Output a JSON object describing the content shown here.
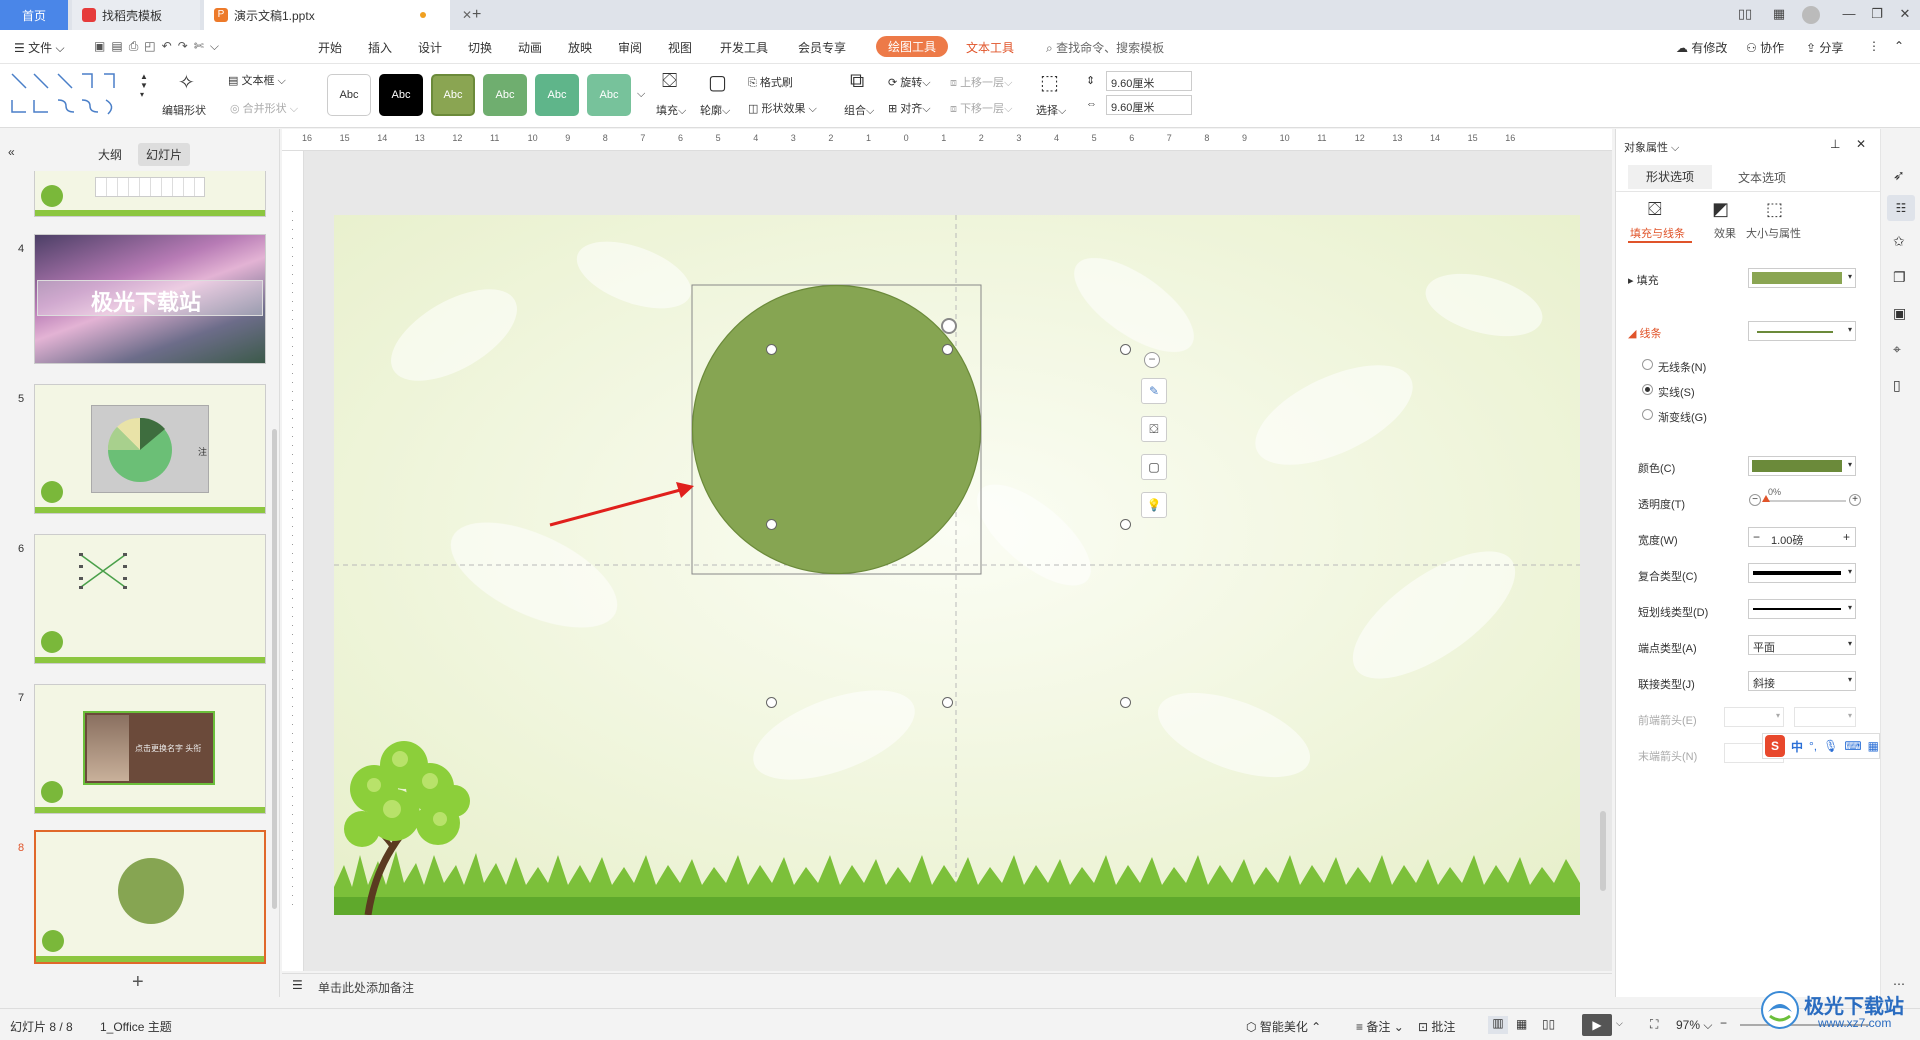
{
  "titlebar": {
    "tab_home": "首页",
    "tab_templates": "找稻壳模板",
    "tab_doc": "演示文稿1.pptx",
    "new_tab": "+"
  },
  "menubar": {
    "file": "文件",
    "items": [
      "开始",
      "插入",
      "设计",
      "切换",
      "动画",
      "放映",
      "审阅",
      "视图",
      "开发工具",
      "会员专享"
    ],
    "draw_tools": "绘图工具",
    "text_tools": "文本工具",
    "search": "查找命令、搜索模板",
    "modified": "有修改",
    "collab": "协作",
    "share": "分享"
  },
  "ribbon": {
    "edit_shape": "编辑形状",
    "textbox": "文本框",
    "merge_shape": "合并形状",
    "style_chips": [
      "Abc",
      "Abc",
      "Abc",
      "Abc",
      "Abc",
      "Abc"
    ],
    "fill": "填充",
    "outline": "轮廓",
    "format_painter": "格式刷",
    "shape_effect": "形状效果",
    "rotate": "旋转",
    "align": "对齐",
    "group": "组合",
    "bring_forward": "上移一层",
    "send_backward": "下移一层",
    "select": "选择",
    "height": "9.60厘米",
    "width": "9.60厘米"
  },
  "leftpanel": {
    "tab_outline": "大纲",
    "tab_slides": "幻灯片",
    "slide_numbers": [
      "4",
      "5",
      "6",
      "7",
      "8"
    ],
    "slide4_text": "极光下载站",
    "slide7_text": "点击更换名字 头衔",
    "slide5_note": "注",
    "add": "+"
  },
  "ruler": {
    "labels": [
      "16",
      "15",
      "14",
      "13",
      "12",
      "11",
      "10",
      "9",
      "8",
      "7",
      "6",
      "5",
      "4",
      "3",
      "2",
      "1",
      "0",
      "1",
      "2",
      "3",
      "4",
      "5",
      "6",
      "7",
      "8",
      "9",
      "10",
      "11",
      "12",
      "13",
      "14",
      "15",
      "16"
    ]
  },
  "notes": {
    "placeholder": "单击此处添加备注"
  },
  "rightpanel": {
    "title": "对象属性",
    "tab_shape": "形状选项",
    "tab_text": "文本选项",
    "sub_fill_line": "填充与线条",
    "sub_effect": "效果",
    "sub_size": "大小与属性",
    "fill": "填充",
    "line": "线条",
    "no_line": "无线条(N)",
    "solid_line": "实线(S)",
    "gradient_line": "渐变线(G)",
    "color": "颜色(C)",
    "transparency": "透明度(T)",
    "transparency_value": "0%",
    "width": "宽度(W)",
    "width_value": "1.00磅",
    "compound": "复合类型(C)",
    "dash": "短划线类型(D)",
    "cap": "端点类型(A)",
    "cap_value": "平面",
    "join": "联接类型(J)",
    "join_value": "斜接",
    "begin_arrow": "前端箭头(E)",
    "end_arrow": "末端箭头(N)",
    "fill_color": "#8aa552",
    "line_color": "#6b8a3a"
  },
  "statusbar": {
    "slide_info": "幻灯片 8 / 8",
    "theme": "1_Office 主题",
    "beautify": "智能美化",
    "notes": "备注",
    "comments": "批注",
    "zoom": "97%"
  },
  "watermark": {
    "text": "极光下载站",
    "url": "www.xz7.com"
  },
  "colors": {
    "accent": "#ed7a48",
    "circle": "#86a552",
    "arrow": "#e0201c",
    "home_tab": "#4a86e8"
  }
}
